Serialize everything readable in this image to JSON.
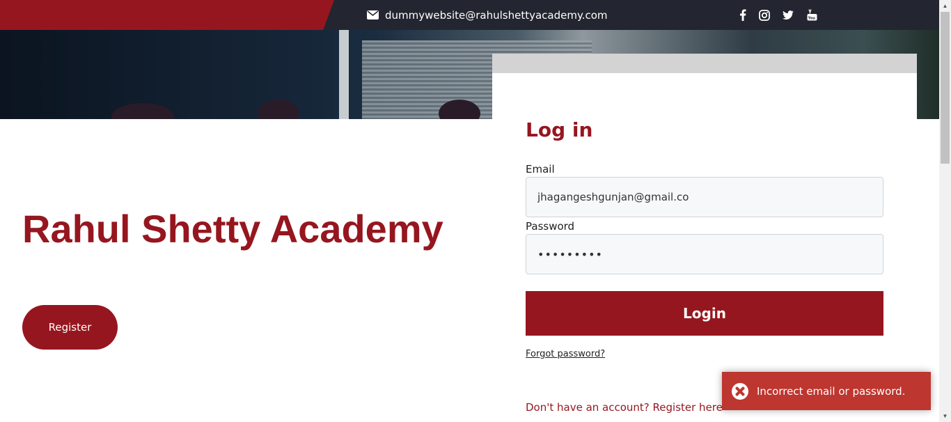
{
  "topbar": {
    "email": "dummywebsite@rahulshettyacademy.com",
    "social_icons": [
      "facebook-icon",
      "instagram-icon",
      "twitter-icon",
      "youtube-icon"
    ]
  },
  "main": {
    "site_title": "Rahul Shetty Academy",
    "register_button": "Register"
  },
  "login": {
    "title": "Log in",
    "email_label": "Email",
    "email_value": "jhagangeshgunjan@gmail.co",
    "password_label": "Password",
    "password_value": "•••••••••",
    "login_button": "Login",
    "forgot_link": "Forgot password?",
    "register_link": "Don't have an account? Register here"
  },
  "toast": {
    "message": "Incorrect email or password."
  },
  "colors": {
    "brand_red": "#96161f",
    "topbar_dark": "#232630",
    "toast_red": "#bd362f"
  }
}
